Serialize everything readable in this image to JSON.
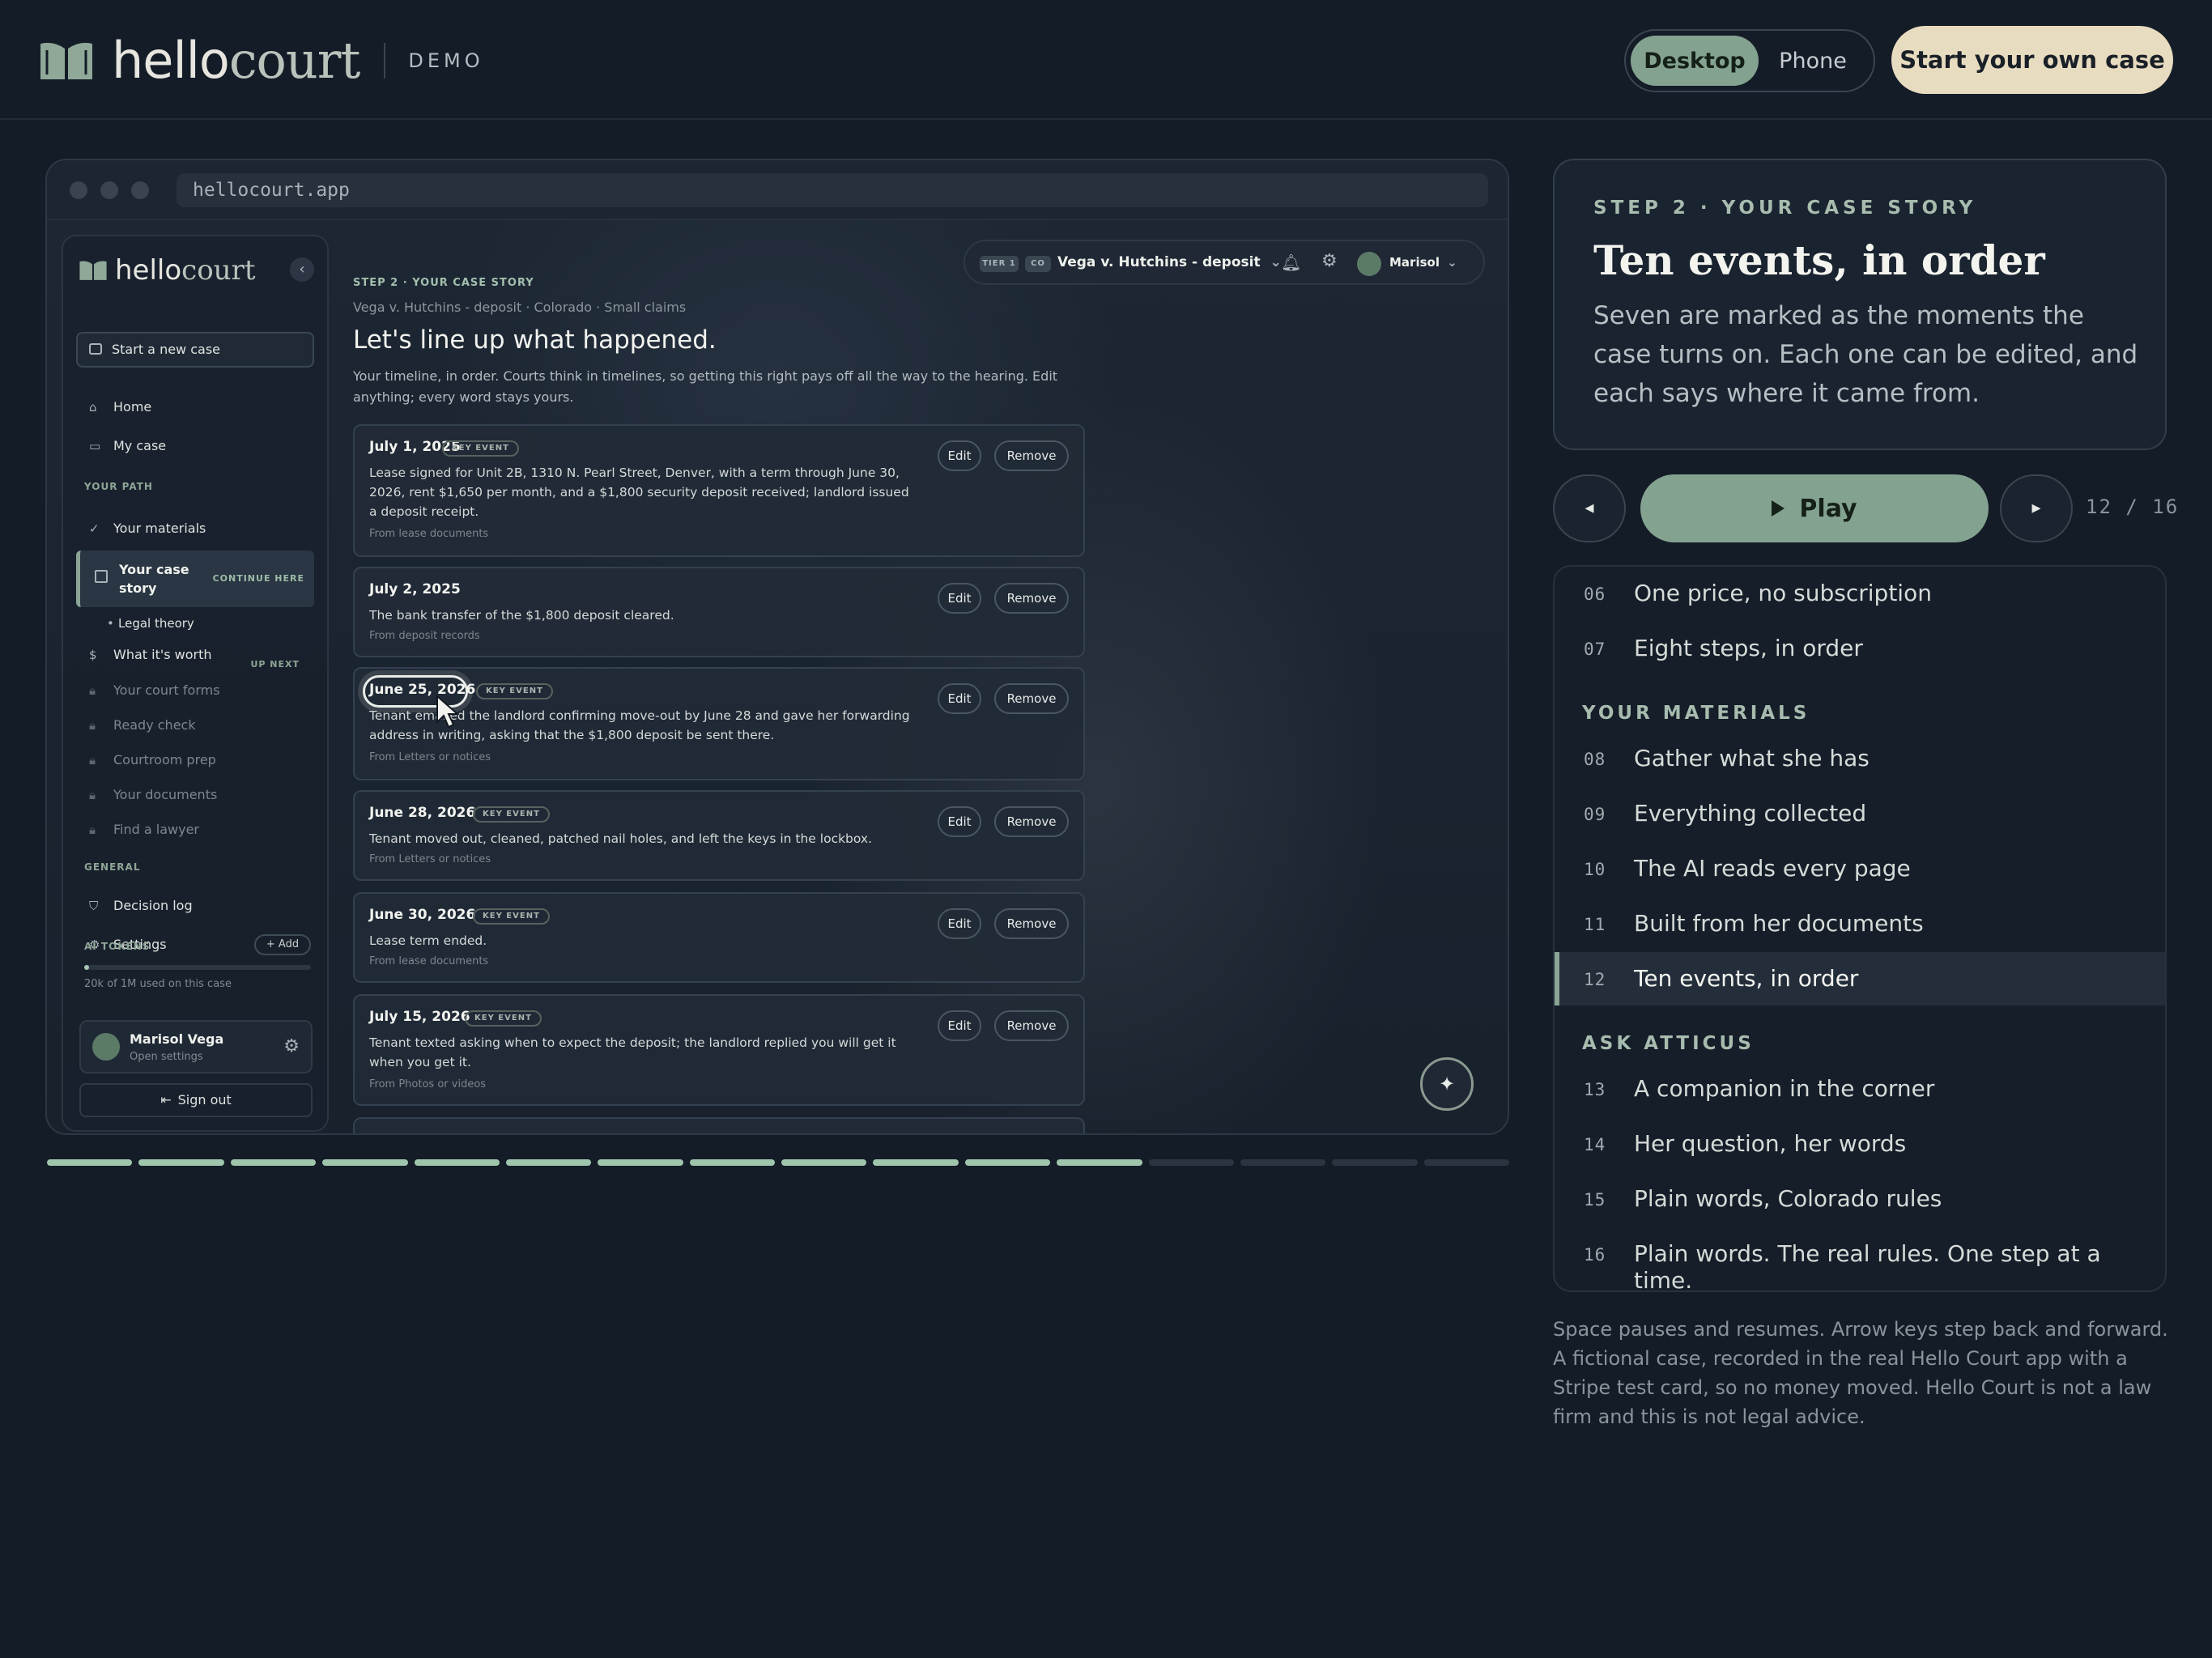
{
  "header": {
    "brand_a": "hello",
    "brand_b": "court",
    "demo_label": "DEMO",
    "view_toggle": [
      "Desktop",
      "Phone"
    ],
    "active_view": "Desktop",
    "cta_label": "Start your own case",
    "accent": "#84a290",
    "cta_color": "#e8dcc0"
  },
  "browser": {
    "url": "hellocourt.app"
  },
  "app": {
    "brand_a": "hello",
    "brand_b": "court",
    "new_case": "Start a new case",
    "nav_home": "Home",
    "nav_my_case": "My case",
    "section_path": "YOUR PATH",
    "path_items": [
      {
        "label": "Your materials",
        "icon": "check-circle-icon"
      },
      {
        "label": "Your case story",
        "badge": "CONTINUE HERE",
        "icon": "bookmark-icon"
      },
      {
        "label": "Legal theory"
      },
      {
        "label": "What it's worth",
        "badge": "UP NEXT",
        "icon": "dollar-icon"
      },
      {
        "label": "Your court forms",
        "icon": "lock-icon"
      },
      {
        "label": "Ready check",
        "icon": "lock-icon"
      },
      {
        "label": "Courtroom prep",
        "icon": "lock-icon"
      },
      {
        "label": "Your documents",
        "icon": "lock-icon"
      },
      {
        "label": "Find a lawyer",
        "icon": "lock-icon"
      }
    ],
    "section_general": "GENERAL",
    "nav_decision_log": "Decision log",
    "nav_settings": "Settings",
    "tokens_label": "AI TOKENS",
    "tokens_add": "+ Add",
    "tokens_used": "20k of 1M used on this case",
    "tokens_fraction": 0.02,
    "user_name": "Marisol Vega",
    "user_sub": "Open settings",
    "sign_out": "Sign out",
    "top": {
      "tier": "TIER 1",
      "state": "CO",
      "case": "Vega v. Hutchins - deposit",
      "user": "Marisol"
    },
    "step": "STEP 2 · YOUR CASE STORY",
    "sub": "Vega v. Hutchins - deposit · Colorado · Small claims",
    "title": "Let's line up what happened.",
    "desc": "Your timeline, in order. Courts think in timelines, so getting this right pays off all the way to the hearing. Edit anything; every word stays yours.",
    "key_label": "KEY EVENT",
    "edit_label": "Edit",
    "remove_label": "Remove",
    "events": [
      {
        "date": "July 1, 2025",
        "key": true,
        "text": "Lease signed for Unit 2B, 1310 N. Pearl Street, Denver, with a term through June 30, 2026, rent $1,650 per month, and a $1,800 security deposit received; landlord issued a deposit receipt.",
        "source": "From lease documents"
      },
      {
        "date": "July 2, 2025",
        "key": false,
        "text": "The bank transfer of the $1,800 deposit cleared.",
        "source": "From deposit records"
      },
      {
        "date": "June 25, 2026",
        "key": true,
        "text": "Tenant emailed the landlord confirming move-out by June 28 and gave her forwarding address in writing, asking that the $1,800 deposit be sent there.",
        "source": "From Letters or notices"
      },
      {
        "date": "June 28, 2026",
        "key": true,
        "text": "Tenant moved out, cleaned, patched nail holes, and left the keys in the lockbox.",
        "source": "From Letters or notices"
      },
      {
        "date": "June 30, 2026",
        "key": true,
        "text": "Lease term ended.",
        "source": "From lease documents"
      },
      {
        "date": "July 15, 2026",
        "key": true,
        "text": "Tenant texted asking when to expect the deposit; the landlord replied you will get it when you get it.",
        "source": "From Photos or videos"
      }
    ]
  },
  "progress": {
    "total": 16,
    "current": 12
  },
  "card": {
    "step": "STEP 2 · YOUR CASE STORY",
    "title": "Ten events, in order",
    "body": "Seven are marked as the moments the case turns on. Each one can be edited, and each says where it came from."
  },
  "controls": {
    "play": "Play",
    "counter": "12 / 16"
  },
  "chapters": {
    "top": [
      {
        "num": "06",
        "label": "One price, no subscription"
      },
      {
        "num": "07",
        "label": "Eight steps, in order"
      }
    ],
    "group1": "YOUR MATERIALS",
    "mat": [
      {
        "num": "08",
        "label": "Gather what she has"
      },
      {
        "num": "09",
        "label": "Everything collected"
      },
      {
        "num": "10",
        "label": "The AI reads every page"
      },
      {
        "num": "11",
        "label": "Built from her documents"
      },
      {
        "num": "12",
        "label": "Ten events, in order"
      }
    ],
    "group2": "ASK ATTICUS",
    "ask": [
      {
        "num": "13",
        "label": "A companion in the corner"
      },
      {
        "num": "14",
        "label": "Her question, her words"
      },
      {
        "num": "15",
        "label": "Plain words, Colorado rules"
      },
      {
        "num": "16",
        "label": "Plain words. The real rules. One step at a time."
      }
    ]
  },
  "footer": "Space pauses and resumes. Arrow keys step back and forward. A fictional case, recorded in the real Hello Court app with a Stripe test card, so no money moved. Hello Court is not a law firm and this is not legal advice."
}
